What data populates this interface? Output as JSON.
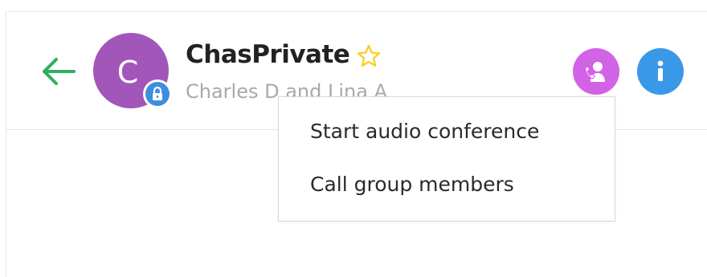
{
  "header": {
    "title": "ChasPrivate",
    "subtitle": "Charles D and Lina A",
    "avatar_initial": "C"
  },
  "icons": {
    "back": "arrow-left-icon",
    "favorite": "star-outline-icon",
    "lock": "lock-icon",
    "audio": "phone-person-icon",
    "info": "info-icon"
  },
  "colors": {
    "back_arrow": "#2fae5f",
    "avatar": "#a356b9",
    "lock_badge": "#3d8fdd",
    "star": "#f5d22a",
    "audio_button": "#d262e6",
    "info_button": "#3a98e8"
  },
  "menu": {
    "items": [
      {
        "label": "Start audio conference"
      },
      {
        "label": "Call group members"
      }
    ]
  }
}
